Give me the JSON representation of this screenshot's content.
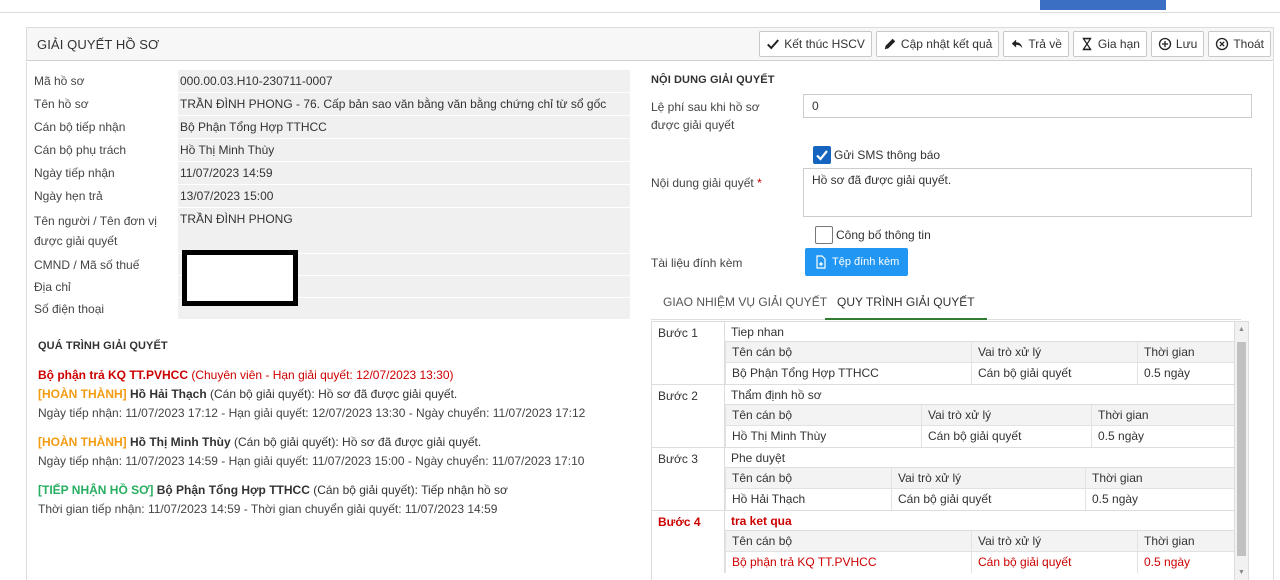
{
  "header": {
    "title": "GIẢI QUYẾT HỒ SƠ",
    "buttons": [
      {
        "name": "finish-button",
        "icon": "check-icon",
        "label": "Kết thúc HSCV"
      },
      {
        "name": "update-result-button",
        "icon": "pencil-icon",
        "label": "Cập nhật kết quả"
      },
      {
        "name": "return-button",
        "icon": "reply-icon",
        "label": "Trả về"
      },
      {
        "name": "extend-button",
        "icon": "hourglass-icon",
        "label": "Gia hạn"
      },
      {
        "name": "save-button",
        "icon": "plus-circle-icon",
        "label": "Lưu"
      },
      {
        "name": "exit-button",
        "icon": "close-circle-icon",
        "label": "Thoát"
      }
    ]
  },
  "info": {
    "ma_ho_so": {
      "label": "Mã hồ sơ",
      "value": "000.00.03.H10-230711-0007"
    },
    "ten_ho_so": {
      "label": "Tên hồ sơ",
      "value": "TRẦN ĐÌNH PHONG - 76. Cấp bản sao văn bằng văn bằng chứng chỉ từ sổ gốc"
    },
    "can_bo_tiep_nhan": {
      "label": "Cán bộ tiếp nhận",
      "value": "Bộ Phận Tổng Hợp TTHCC"
    },
    "can_bo_phu_trach": {
      "label": "Cán bộ phụ trách",
      "value": "Hồ Thị Minh Thùy"
    },
    "ngay_tiep_nhan": {
      "label": "Ngày tiếp nhận",
      "value": "11/07/2023 14:59"
    },
    "ngay_hen_tra": {
      "label": "Ngày hẹn trả",
      "value": "13/07/2023 15:00"
    },
    "ten_nguoi": {
      "label_line1": "Tên người / Tên đơn vị",
      "label_line2": "được giải quyết",
      "value": "TRẦN ĐÌNH PHONG"
    },
    "cmnd": {
      "label": "CMND / Mã số thuế",
      "value": ""
    },
    "dia_chi": {
      "label": "Địa chỉ",
      "value": ""
    },
    "so_dien_thoai": {
      "label": "Số điện thoại",
      "value": ""
    }
  },
  "history": {
    "title": "QUÁ TRÌNH GIẢI QUYẾT",
    "current": {
      "dept": "Bộ phận trả KQ TT.PVHCC",
      "detail": " (Chuyên viên - Hạn giải quyết: 12/07/2023 13:30)"
    },
    "items": [
      {
        "tag": "[HOÀN THÀNH]",
        "tag_type": "done",
        "person": "Hồ Hải Thạch",
        "role": " (Cán bộ giải quyết): Hồ sơ đã được giải quyết.",
        "sub": "Ngày tiếp nhận: 11/07/2023 17:12 - Hạn giải quyết: 12/07/2023 13:30 - Ngày chuyển: 11/07/2023 17:12"
      },
      {
        "tag": "[HOÀN THÀNH]",
        "tag_type": "done",
        "person": "Hồ Thị Minh Thùy",
        "role": " (Cán bộ giải quyết): Hồ sơ đã được giải quyết.",
        "sub": "Ngày tiếp nhận: 11/07/2023 14:59 - Hạn giải quyết: 11/07/2023 15:00 - Ngày chuyển: 11/07/2023 17:10"
      },
      {
        "tag": "[TIẾP NHẬN HỒ SƠ]",
        "tag_type": "recv",
        "person": "Bộ Phận Tổng Hợp TTHCC",
        "role": " (Cán bộ giải quyết): Tiếp nhận hồ sơ",
        "sub": "Thời gian tiếp nhận: 11/07/2023 14:59 - Thời gian chuyển giải quyết: 11/07/2023 14:59"
      }
    ]
  },
  "resolution": {
    "title": "NỘI DUNG GIẢI QUYẾT",
    "fee_label_1": "Lệ phí sau khi hồ sơ",
    "fee_label_2": "được giải quyết",
    "fee_value": "0",
    "sms_label": "Gửi SMS thông báo",
    "content_label": "Nội dung giải quyết",
    "required_mark": "*",
    "content_value": "Hồ sơ đã được giải quyết.",
    "publish_label": "Công bố thông tin",
    "attach_label": "Tài liệu đính kèm",
    "attach_button": "Tệp đính kèm"
  },
  "tabs": [
    {
      "label": "GIAO NHIỆM VỤ GIẢI QUYẾT",
      "active": false
    },
    {
      "label": "QUY TRÌNH GIẢI QUYẾT",
      "active": true
    }
  ],
  "steps": {
    "col_officer": "Tên cán bộ",
    "col_role": "Vai trò xử lý",
    "col_time": "Thời gian",
    "rows": [
      {
        "step": "Bước 1",
        "name": "Tiep nhan",
        "officer": "Bộ Phận Tổng Hợp TTHCC",
        "role": "Cán bộ giải quyết",
        "time": "0.5 ngày"
      },
      {
        "step": "Bước 2",
        "name": "Thẩm định hồ sơ",
        "officer": "Hồ Thị Minh Thùy",
        "role": "Cán bộ giải quyết",
        "time": "0.5 ngày"
      },
      {
        "step": "Bước 3",
        "name": "Phe duyệt",
        "officer": "Hồ Hải Thạch",
        "role": "Cán bộ giải quyết",
        "time": "0.5 ngày"
      },
      {
        "step": "Bước 4",
        "name": "tra ket qua",
        "officer": "Bộ phận trả KQ TT.PVHCC",
        "role": "Cán bộ giải quyết",
        "time": "0.5 ngày"
      }
    ]
  }
}
